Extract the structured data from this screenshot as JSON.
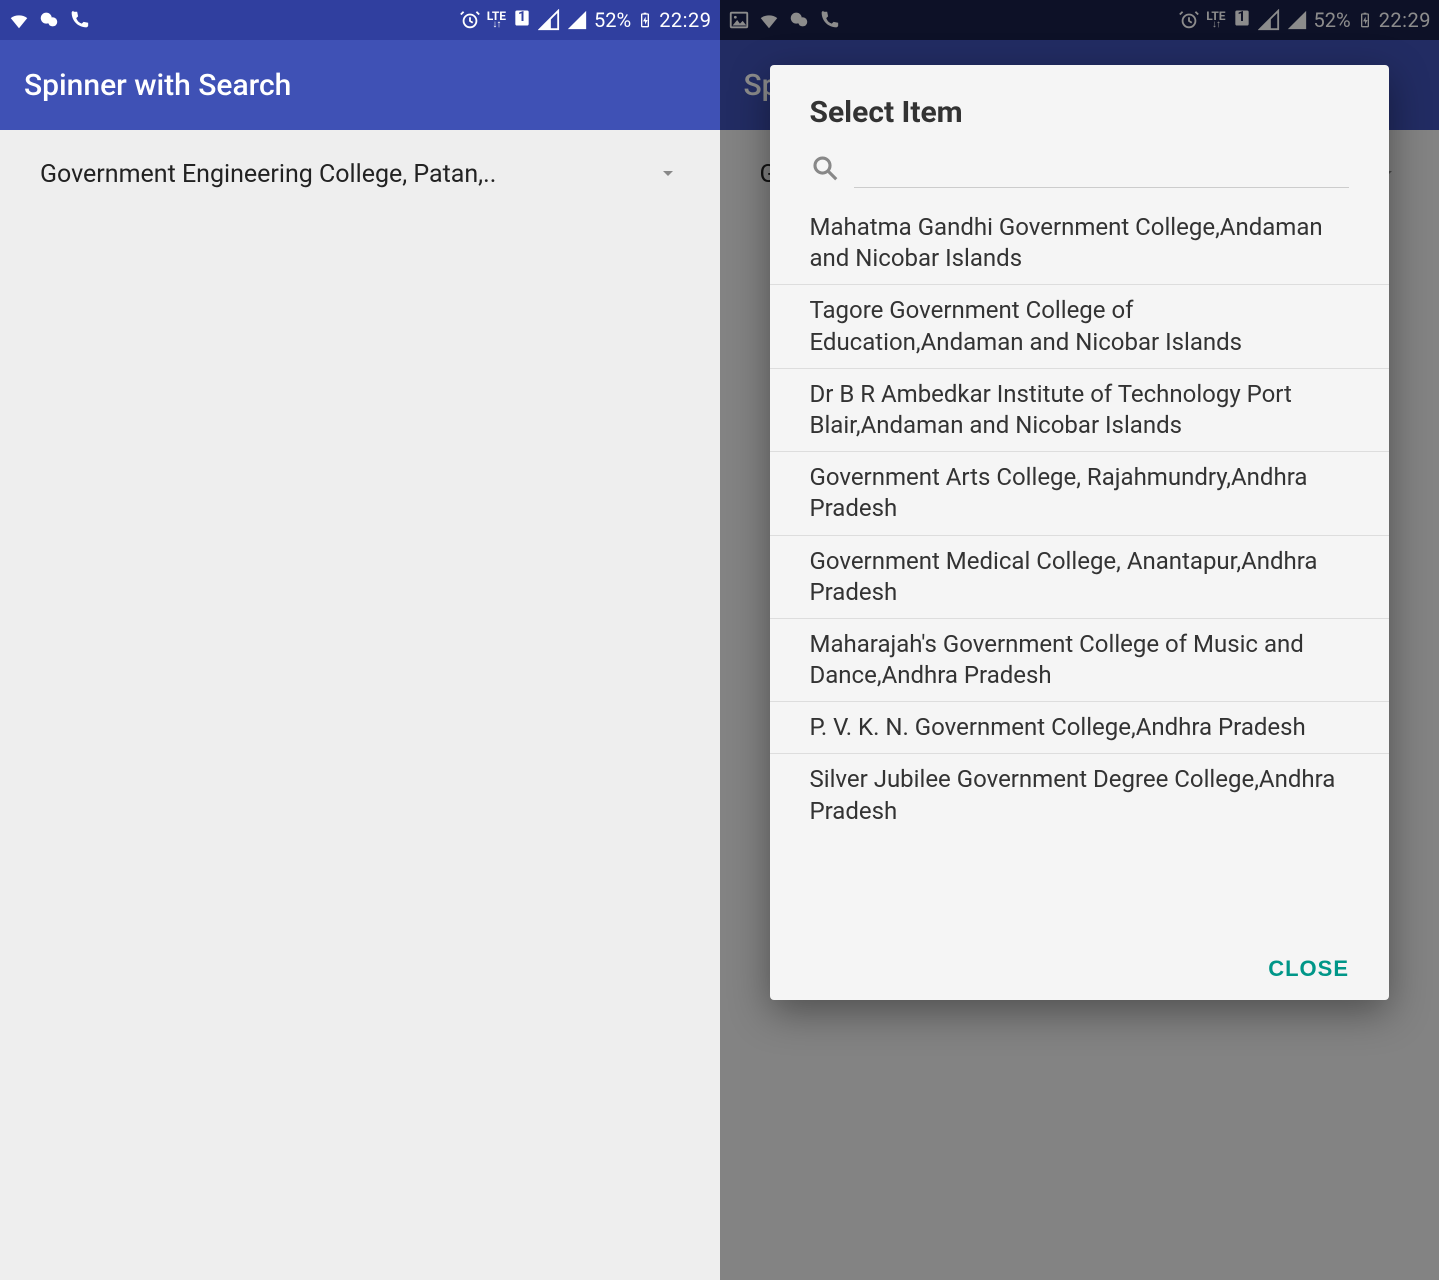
{
  "status": {
    "battery_pct": "52%",
    "time": "22:29",
    "lte_label": "LTE",
    "sim_slot": "1"
  },
  "app": {
    "title": "Spinner with Search"
  },
  "spinner": {
    "selected_left": "Government Engineering College, Patan,..",
    "selected_right_visible_char": "G"
  },
  "dialog": {
    "title": "Select Item",
    "search_placeholder": "",
    "items": [
      "Mahatma Gandhi Government College,Andaman and Nicobar Islands",
      "Tagore Government College of Education,Andaman and Nicobar Islands",
      "Dr B R Ambedkar Institute of Technology Port Blair,Andaman and Nicobar Islands",
      "Government Arts College, Rajahmundry,Andhra Pradesh",
      "Government Medical College, Anantapur,Andhra Pradesh",
      "Maharajah's Government College of Music and Dance,Andhra Pradesh",
      "P. V. K. N. Government College,Andhra Pradesh",
      "Silver Jubilee Government Degree College,Andhra Pradesh"
    ],
    "close_label": "CLOSE"
  },
  "colors": {
    "primary": "#3f51b5",
    "primary_dark": "#303f9f",
    "overlay_dark": "#192048",
    "accent": "#009688"
  }
}
